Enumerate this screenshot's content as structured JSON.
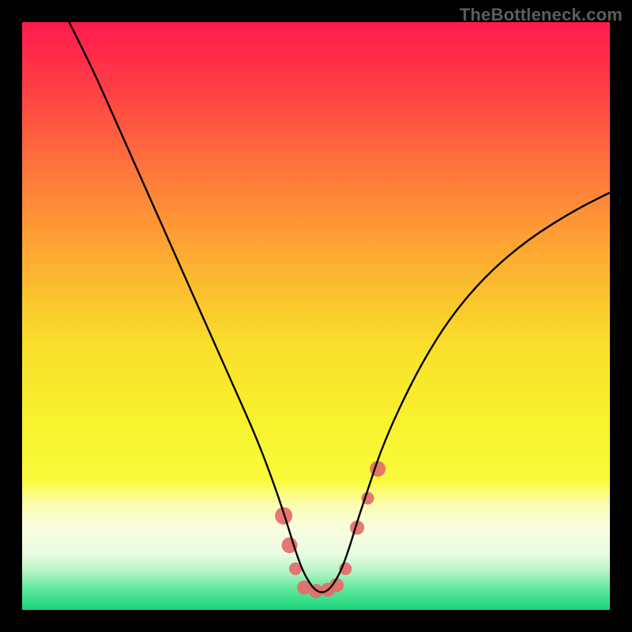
{
  "watermark": "TheBottleneck.com",
  "chart_data": {
    "type": "line",
    "title": "",
    "xlabel": "",
    "ylabel": "",
    "xlim": [
      0,
      100
    ],
    "ylim": [
      0,
      100
    ],
    "background_gradient": {
      "stops": [
        {
          "offset": 0.0,
          "color": "#ff1a4d"
        },
        {
          "offset": 0.1,
          "color": "#ff3a45"
        },
        {
          "offset": 0.25,
          "color": "#fe753b"
        },
        {
          "offset": 0.4,
          "color": "#fdac31"
        },
        {
          "offset": 0.55,
          "color": "#f9df2b"
        },
        {
          "offset": 0.68,
          "color": "#f8f22d"
        },
        {
          "offset": 0.78,
          "color": "#f9fb3b"
        },
        {
          "offset": 0.82,
          "color": "#fafdaf"
        },
        {
          "offset": 0.86,
          "color": "#fafee0"
        },
        {
          "offset": 0.905,
          "color": "#e9fce1"
        },
        {
          "offset": 0.935,
          "color": "#b4f4c4"
        },
        {
          "offset": 0.965,
          "color": "#5de79c"
        },
        {
          "offset": 1.0,
          "color": "#18d57a"
        }
      ]
    },
    "series": [
      {
        "name": "bottleneck-curve",
        "color": "#000000",
        "x": [
          8,
          12,
          16,
          20,
          24,
          28,
          32,
          36,
          40,
          43,
          45,
          46.5,
          48,
          50,
          52,
          54,
          55.5,
          57,
          59,
          61,
          64,
          68,
          73,
          79,
          86,
          94,
          100
        ],
        "y": [
          100,
          92,
          83,
          74,
          65,
          56,
          47,
          38,
          29,
          21,
          15,
          10,
          6,
          3,
          3,
          6,
          10,
          15,
          21,
          27,
          34,
          42,
          50,
          57,
          63,
          68,
          71
        ]
      }
    ],
    "markers": {
      "name": "highlight-dots",
      "color": "#e66a6a",
      "points": [
        {
          "x": 44.5,
          "y": 16,
          "r": 11
        },
        {
          "x": 45.5,
          "y": 11,
          "r": 10
        },
        {
          "x": 46.5,
          "y": 7,
          "r": 8
        },
        {
          "x": 48.0,
          "y": 3.8,
          "r": 9
        },
        {
          "x": 50.0,
          "y": 3.2,
          "r": 9
        },
        {
          "x": 52.0,
          "y": 3.4,
          "r": 9
        },
        {
          "x": 53.5,
          "y": 4.2,
          "r": 9
        },
        {
          "x": 55.0,
          "y": 7,
          "r": 8
        },
        {
          "x": 57.0,
          "y": 14,
          "r": 9
        },
        {
          "x": 58.8,
          "y": 19,
          "r": 8
        },
        {
          "x": 60.5,
          "y": 24,
          "r": 10
        }
      ]
    }
  }
}
